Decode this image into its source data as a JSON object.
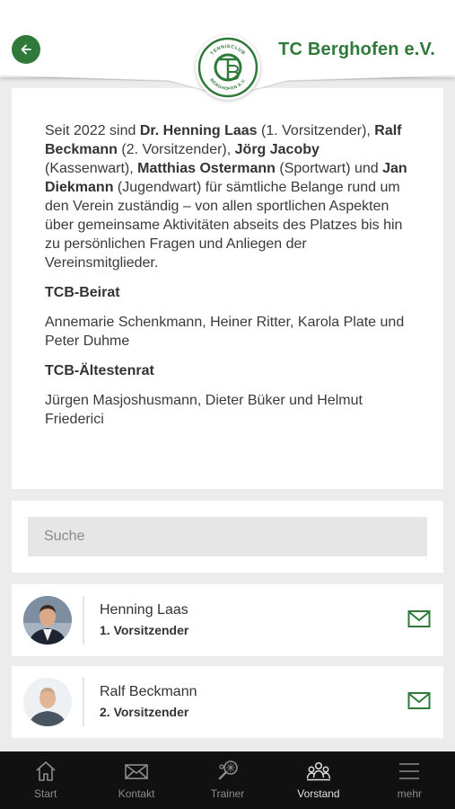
{
  "header": {
    "title": "TC Berghofen e.V.",
    "logo_text_top": "TENNISCLUB",
    "logo_text_bottom": "BERGHOFEN E.V.",
    "logo_letters": "TCB"
  },
  "intro": {
    "p1_a": "Seit 2022 sind ",
    "p1_n1": "Dr. Henning Laas",
    "p1_b": " (1. Vorsitzender), ",
    "p1_n2": "Ralf  Beckmann",
    "p1_c": " (2. Vorsitzender), ",
    "p1_n3": "Jörg Jacoby",
    "p1_d": " (Kassenwart), ",
    "p1_n4": "Matthias Ostermann",
    "p1_e": " (Sportwart) und ",
    "p1_n5": "Jan Diekmann",
    "p1_f": " (Jugendwart) für sämtliche Belange rund um den Verein zuständig – von allen sportlichen Aspekten über gemeinsame Aktivitäten abseits des Platzes bis hin zu persönlichen Fragen und Anliegen der Vereinsmitglieder.",
    "beirat_heading": "TCB-Beirat",
    "beirat_text": "Annemarie Schenkmann, Heiner Ritter, Karola Plate und Peter Duhme",
    "aeltestenrat_heading": "TCB-Ältestenrat",
    "aeltestenrat_text": "Jürgen Masjoshusmann, Dieter Büker und Helmut Friederici"
  },
  "search": {
    "placeholder": "Suche",
    "value": ""
  },
  "members": [
    {
      "name": "Henning Laas",
      "role": "1. Vorsitzender",
      "icon": "mail-icon"
    },
    {
      "name": "Ralf Beckmann",
      "role": "2. Vorsitzender",
      "icon": "mail-icon"
    }
  ],
  "tabbar": {
    "items": [
      {
        "label": "Start",
        "icon": "home-icon"
      },
      {
        "label": "Kontakt",
        "icon": "envelope-icon"
      },
      {
        "label": "Trainer",
        "icon": "tennis-racket-icon"
      },
      {
        "label": "Vorstand",
        "icon": "group-icon"
      },
      {
        "label": "mehr",
        "icon": "menu-icon"
      }
    ],
    "active": "Vorstand"
  },
  "colors": {
    "accent": "#2f7a3a",
    "tabbar_bg": "#111111",
    "page_bg": "#ececec"
  }
}
